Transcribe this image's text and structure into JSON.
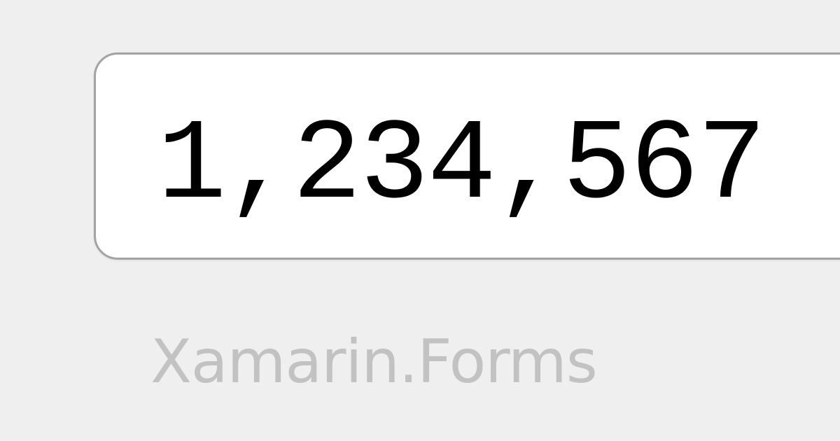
{
  "entry": {
    "value": "1,234,567"
  },
  "caption": {
    "text": "Xamarin.Forms"
  },
  "colors": {
    "background": "#efefef",
    "entry_background": "#ffffff",
    "entry_border": "#a3a3a3",
    "entry_text": "#000000",
    "caption_text": "#c2c2c2"
  }
}
